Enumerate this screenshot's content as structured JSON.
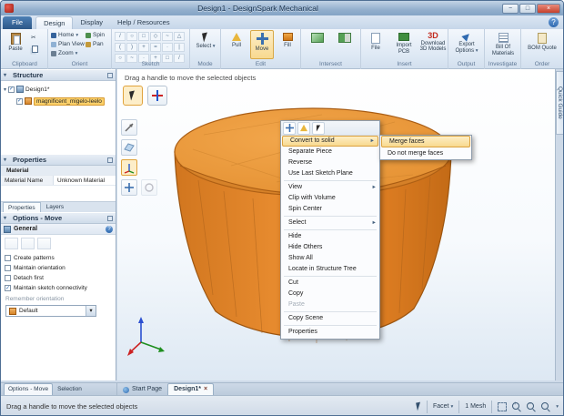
{
  "window": {
    "title": "Design1 - DesignSpark Mechanical"
  },
  "menubar": {
    "file": "File",
    "tabs": [
      "Design",
      "Display",
      "Help / Resources"
    ]
  },
  "ribbon": {
    "clipboard": {
      "label": "Clipboard",
      "paste": "Paste"
    },
    "orient": {
      "label": "Orient",
      "home": "Home",
      "plan_view": "Plan View",
      "spin": "Spin",
      "pan": "Pan",
      "zoom": "Zoom"
    },
    "sketch": {
      "label": "Sketch"
    },
    "mode": {
      "label": "Mode",
      "select": "Select"
    },
    "edit": {
      "label": "Edit",
      "pull": "Pull",
      "move": "Move",
      "fill": "Fill"
    },
    "intersect": {
      "label": "Intersect"
    },
    "insert": {
      "label": "Insert",
      "file": "File",
      "import_pcb": "Import PCB",
      "download_3d": "Download 3D Models"
    },
    "output": {
      "label": "Output",
      "export_options": "Export Options"
    },
    "investigate": {
      "label": "Investigate",
      "bom": "Bill Of Materials"
    },
    "order": {
      "label": "Order",
      "bom_quote": "BOM Quote"
    }
  },
  "structure_panel": {
    "header": "Structure",
    "root_item": "Design1*",
    "child_item": "magnificent_migelo-leelo"
  },
  "properties_panel": {
    "header": "Properties",
    "group": "Material",
    "row_name": "Material Name",
    "row_value": "Unknown Material",
    "tab_properties": "Properties",
    "tab_layers": "Layers"
  },
  "options_panel": {
    "header": "Options - Move",
    "general_label": "General",
    "checkboxes": [
      {
        "label": "Create patterns",
        "checked": false
      },
      {
        "label": "Maintain orientation",
        "checked": false
      },
      {
        "label": "Detach first",
        "checked": false
      },
      {
        "label": "Maintain sketch connectivity",
        "checked": true
      }
    ],
    "remember_label": "Remember orientation",
    "orientation_value": "Default"
  },
  "canvas": {
    "hint": "Drag a handle to move the selected objects",
    "quick_guide": "Quick Guide"
  },
  "context_menu": {
    "items": [
      {
        "label": "Convert to solid",
        "submenu": true,
        "highlighted": true
      },
      {
        "label": "Separate Piece"
      },
      {
        "label": "Reverse"
      },
      {
        "label": "Use Last Sketch Plane",
        "separator_after": true
      },
      {
        "label": "View",
        "submenu": true
      },
      {
        "label": "Clip with Volume"
      },
      {
        "label": "Spin Center",
        "separator_after": true
      },
      {
        "label": "Select",
        "submenu": true,
        "separator_after": true
      },
      {
        "label": "Hide"
      },
      {
        "label": "Hide Others"
      },
      {
        "label": "Show All"
      },
      {
        "label": "Locate in Structure Tree",
        "separator_after": true
      },
      {
        "label": "Cut"
      },
      {
        "label": "Copy"
      },
      {
        "label": "Paste",
        "disabled": true,
        "separator_after": true
      },
      {
        "label": "Copy Scene",
        "separator_after": true
      },
      {
        "label": "Properties"
      }
    ],
    "submenu": [
      {
        "label": "Merge faces",
        "highlighted": true
      },
      {
        "label": "Do not merge faces"
      }
    ]
  },
  "bottom_tabs": {
    "panel_options": "Options - Move",
    "panel_selection": "Selection",
    "doc_start": "Start Page",
    "doc_design": "Design1*"
  },
  "statusbar": {
    "message": "Drag a handle to move the selected objects",
    "facet": "Facet",
    "mesh_count": "1 Mesh"
  },
  "colors": {
    "object_main": "#e0802a",
    "object_top": "#ec9a3e",
    "selection_highlight": "#fbd06a",
    "titlebar": "#9db5cf"
  }
}
